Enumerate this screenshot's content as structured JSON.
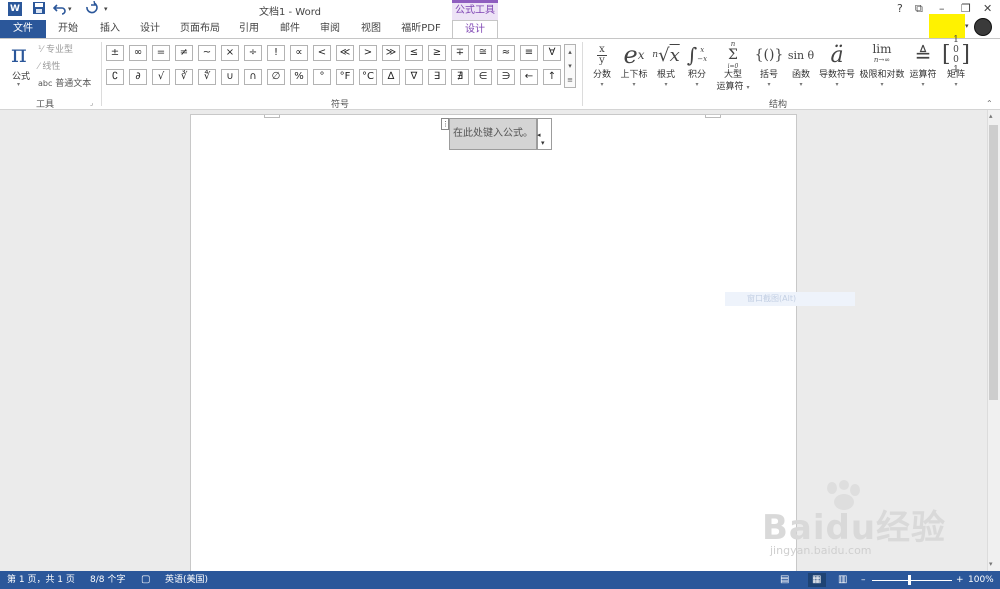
{
  "titlebar": {
    "app_icon": "W",
    "undo_icon": "undo-icon",
    "redo_icon": "redo-icon",
    "doc_title": "文档1 - Word",
    "context_tab_header": "公式工具",
    "help": "?",
    "restore_ribbon": "⧉",
    "minimize": "–",
    "maximize": "❐",
    "close": "✕"
  },
  "tabs": [
    "文件",
    "开始",
    "插入",
    "设计",
    "页面布局",
    "引用",
    "邮件",
    "审阅",
    "视图",
    "福昕PDF",
    "设计"
  ],
  "ribbon": {
    "tools": {
      "equation_label": "公式",
      "professional": "专业型",
      "linear": "线性",
      "normal_text_prefix": "abc",
      "normal_text": "普通文本",
      "group_label": "工具"
    },
    "symbols": {
      "row1": [
        "±",
        "∞",
        "=",
        "≠",
        "~",
        "×",
        "÷",
        "!",
        "∝",
        "<",
        "≪",
        ">",
        "≫",
        "≤",
        "≥",
        "∓",
        "≅",
        "≈",
        "≡",
        "∀"
      ],
      "row2": [
        "∁",
        "∂",
        "√",
        "∛",
        "∜",
        "∪",
        "∩",
        "∅",
        "%",
        "°",
        "°F",
        "°C",
        "∆",
        "∇",
        "∃",
        "∄",
        "∈",
        "∋",
        "←",
        "↑"
      ],
      "group_label": "符号"
    },
    "structures": {
      "items": [
        {
          "label": "分数",
          "dropdown": true
        },
        {
          "label": "上下标",
          "dropdown": true
        },
        {
          "label": "根式",
          "dropdown": true
        },
        {
          "label": "积分",
          "dropdown": true
        },
        {
          "label": "大型",
          "label2": "运算符",
          "dropdown": true
        },
        {
          "label": "括号",
          "dropdown": true
        },
        {
          "label": "函数",
          "dropdown": true
        },
        {
          "label": "导数符号",
          "dropdown": true
        },
        {
          "label": "极限和对数",
          "dropdown": true
        },
        {
          "label": "运算符",
          "dropdown": true
        },
        {
          "label": "矩阵",
          "dropdown": true
        }
      ],
      "glyphs": {
        "fraction_num": "x",
        "fraction_den": "y",
        "script_base": "e",
        "script_sup": "x",
        "radical_index": "n",
        "radical_sign": "√",
        "radical_arg": "x",
        "integral": "∫",
        "integral_upper": "x",
        "integral_lower": "−x",
        "sum_upper": "n",
        "sum_sign": "Σ",
        "sum_lower": "i=0",
        "bracket": "{()}",
        "function": "sin θ",
        "accent": "ä",
        "limit": "lim",
        "limit_sub": "n→∞",
        "operator": "≜",
        "matrix_r1": "1 0",
        "matrix_r2": "0 1"
      },
      "group_label": "结构"
    }
  },
  "document": {
    "equation_placeholder": "在此处键入公式。",
    "ghost_tooltip": "窗口截图(Alt)"
  },
  "watermark": {
    "text": "Baidu经验",
    "subtext": "jingyan.baidu.com"
  },
  "statusbar": {
    "page": "第 1 页，共 1 页",
    "words": "8/8 个字",
    "language": "英语(美国)",
    "zoom": "100%",
    "zoom_minus": "–",
    "zoom_plus": "+"
  },
  "colors": {
    "word_blue": "#2b579a",
    "context_purple": "#7e44b3",
    "highlight_yellow": "#fff200"
  }
}
